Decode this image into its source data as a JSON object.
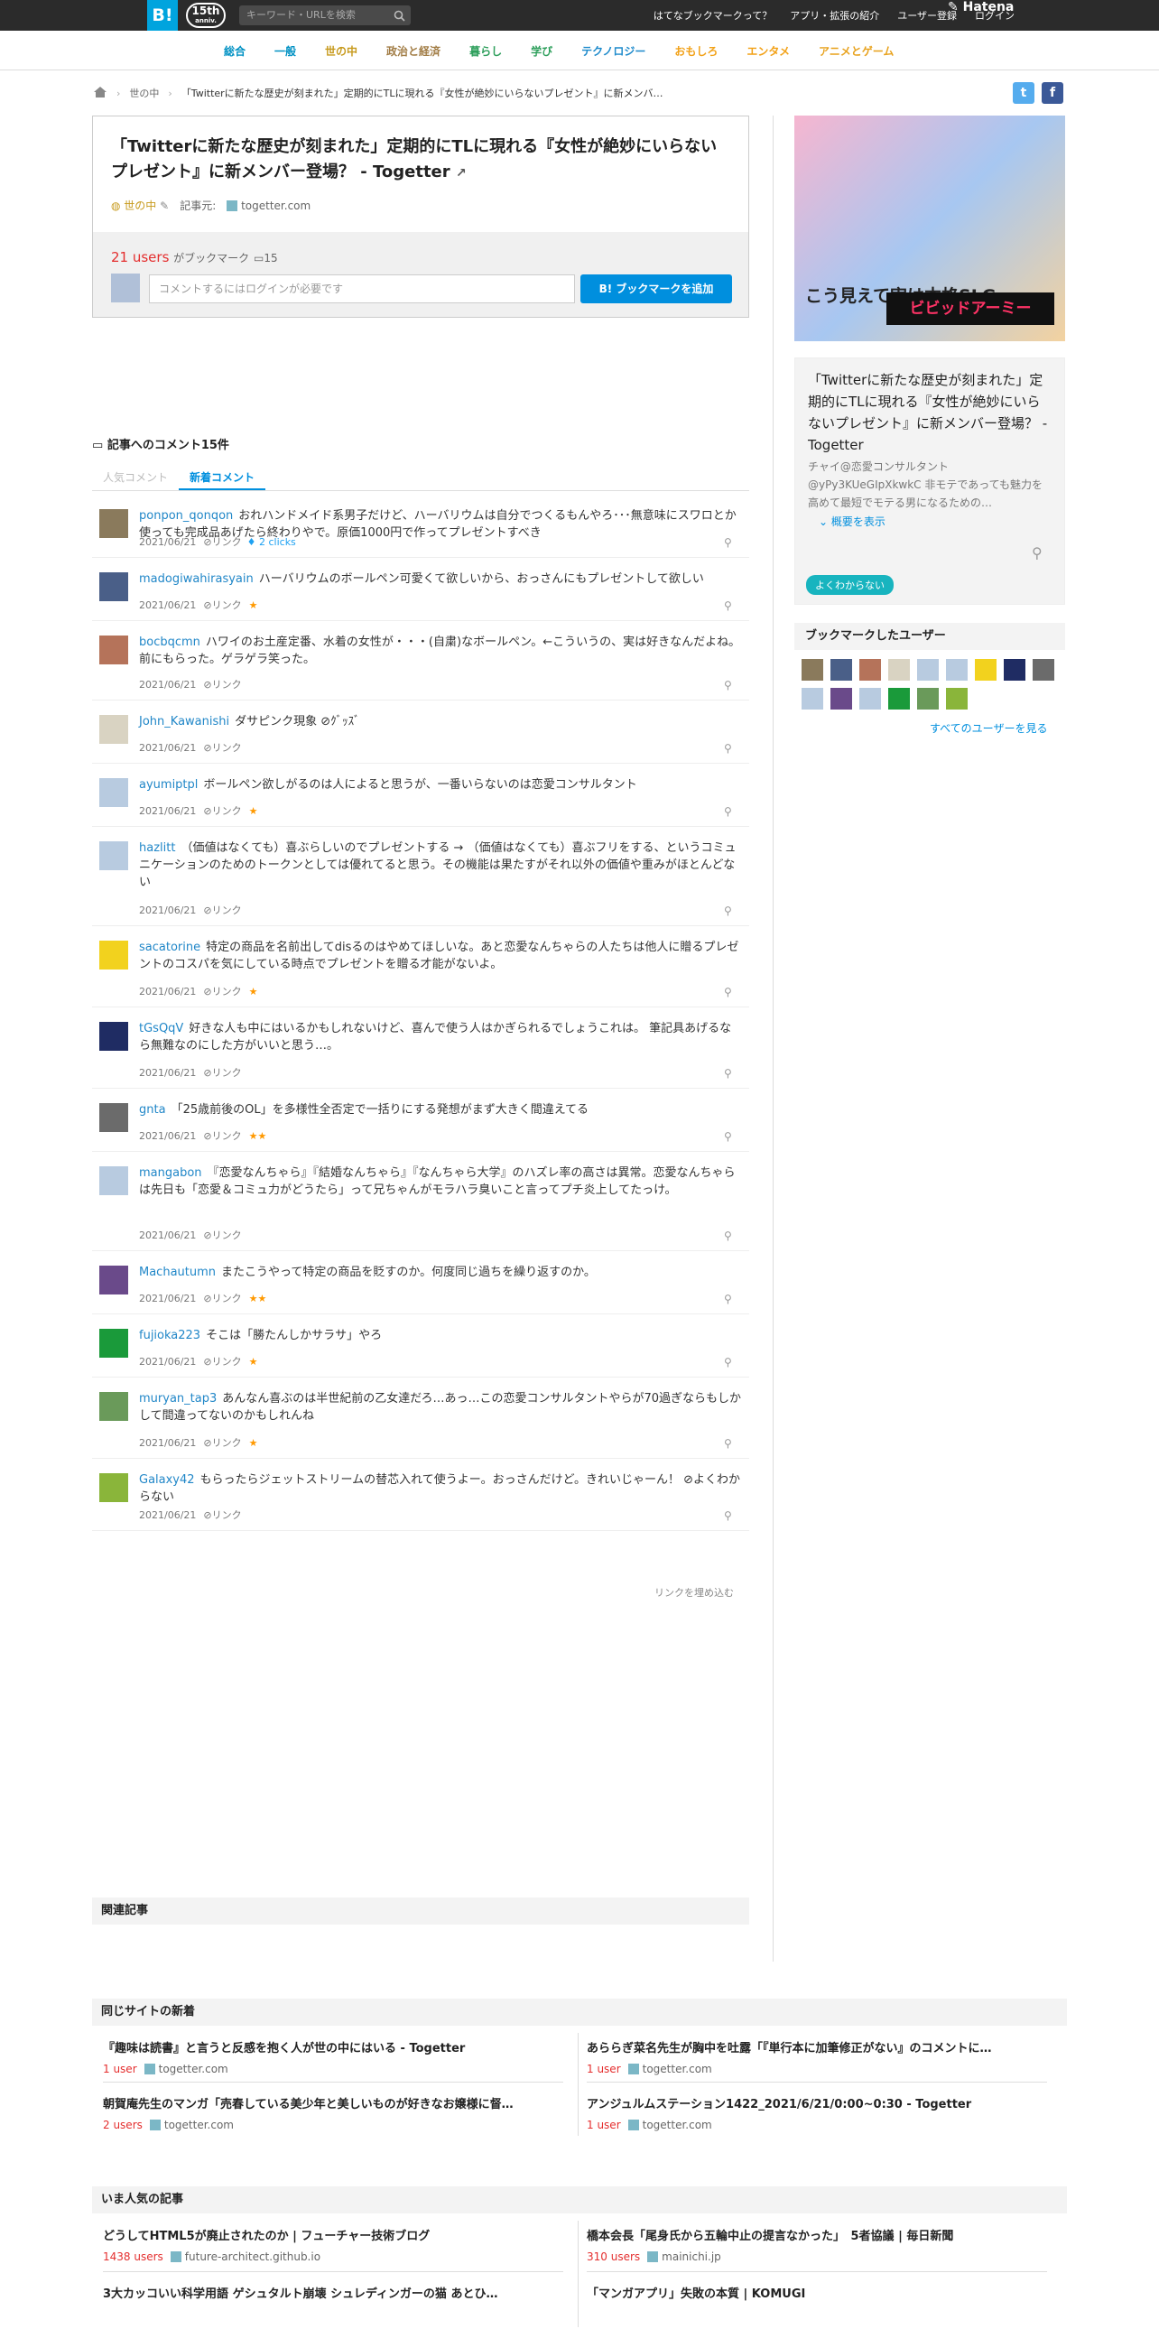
{
  "topbar": {
    "logo": "B!",
    "anniversary": "15th",
    "anniversary_sub": "anniv.",
    "search_placeholder": "キーワード・URLを検索",
    "nav": [
      "はてなブックマークって？",
      "アプリ・拡張の紹介",
      "ユーザー登録",
      "ログイン"
    ],
    "brand": "Hatena"
  },
  "categories": [
    {
      "label": "総合",
      "color": "#0091c3"
    },
    {
      "label": "一般",
      "color": "#0091c3"
    },
    {
      "label": "世の中",
      "color": "#c79a1d"
    },
    {
      "label": "政治と経済",
      "color": "#a27d46"
    },
    {
      "label": "暮らし",
      "color": "#2e9f5c"
    },
    {
      "label": "学び",
      "color": "#2e9f5c"
    },
    {
      "label": "テクノロジー",
      "color": "#1d8acb"
    },
    {
      "label": "おもしろ",
      "color": "#f2a117"
    },
    {
      "label": "エンタメ",
      "color": "#f2a117"
    },
    {
      "label": "アニメとゲーム",
      "color": "#e8a21d"
    }
  ],
  "breadcrumb": {
    "category": "世の中",
    "title": "「Twitterに新たな歴史が刻まれた」定期的にTLに現れる『女性が絶妙にいらないプレゼント』に新メンバ…"
  },
  "entry": {
    "title": "「Twitterに新たな歴史が刻まれた」定期的にTLに現れる『女性が絶妙にいらないプレゼント』に新メンバー登場？ - Togetter",
    "category": "世の中",
    "source_label": "記事元:",
    "source": "togetter.com",
    "users": "21 users",
    "users_suffix": "がブックマーク",
    "comment_count": "15",
    "comment_placeholder": "コメントするにはログインが必要です",
    "add_button": "B! ブックマークを追加"
  },
  "comments_header": "記事へのコメント15件",
  "tabs": [
    "人気コメント",
    "新着コメント"
  ],
  "comments": [
    {
      "user": "ponpon_qonqon",
      "text": "おれハンドメイド系男子だけど、ハーバリウムは自分でつくるもんやろ･･･無意味にスワロとか使っても完成品あげたら終わりやで。原価1000円で作ってプレゼントすべき",
      "date": "2021/06/21",
      "link": "リンク",
      "stars": "",
      "clicks": "2 clicks",
      "avatar": "#8a7a5c"
    },
    {
      "user": "madogiwahirasyain",
      "text": "ハーバリウムのボールペン可愛くて欲しいから、おっさんにもプレゼントして欲しい",
      "date": "2021/06/21",
      "link": "リンク",
      "stars": "★",
      "clicks": "",
      "avatar": "#4a5f88"
    },
    {
      "user": "bocbqcmn",
      "text": "ハワイのお土産定番、水着の女性が・・・(自粛)なボールペン。←こういうの、実は好きなんだよね。前にもらった。ゲラゲラ笑った。",
      "date": "2021/06/21",
      "link": "リンク",
      "stars": "",
      "clicks": "",
      "avatar": "#b5735a"
    },
    {
      "user": "John_Kawanishi",
      "text": "ダサピンク現象  ⊘ｸﾞｯｽﾞ",
      "date": "2021/06/21",
      "link": "リンク",
      "stars": "",
      "clicks": "",
      "avatar": "#d9d3c2"
    },
    {
      "user": "ayumiptpl",
      "text": "ボールペン欲しがるのは人によると思うが、一番いらないのは恋愛コンサルタント",
      "date": "2021/06/21",
      "link": "リンク",
      "stars": "★",
      "clicks": "",
      "avatar": "#b8cbe0"
    },
    {
      "user": "hazlitt",
      "text": "（価値はなくても）喜ぶらしいのでプレゼントする → （価値はなくても）喜ぶフリをする、というコミュニケーションのためのトークンとしては優れてると思う。その機能は果たすがそれ以外の価値や重みがほとんどない",
      "date": "2021/06/21",
      "link": "リンク",
      "stars": "",
      "clicks": "",
      "avatar": "#b8cbe0"
    },
    {
      "user": "sacatorine",
      "text": "特定の商品を名前出してdisるのはやめてほしいな。あと恋愛なんちゃらの人たちは他人に贈るプレゼントのコスパを気にしている時点でプレゼントを贈る才能がないよ。",
      "date": "2021/06/21",
      "link": "リンク",
      "stars": "★",
      "clicks": "",
      "avatar": "#f2d21e"
    },
    {
      "user": "tGsQqV",
      "text": "好きな人も中にはいるかもしれないけど、喜んで使う人はかぎられるでしょうこれは。 筆記具あげるなら無難なのにした方がいいと思う…。",
      "date": "2021/06/21",
      "link": "リンク",
      "stars": "",
      "clicks": "",
      "avatar": "#1f2c63"
    },
    {
      "user": "gnta",
      "text": "「25歳前後のOL」を多様性全否定で一括りにする発想がまず大きく間違えてる",
      "date": "2021/06/21",
      "link": "リンク",
      "stars": "★★",
      "clicks": "",
      "avatar": "#6b6b6b"
    },
    {
      "user": "mangabon",
      "text": "『恋愛なんちゃら』『結婚なんちゃら』『なんちゃら大学』のハズレ率の高さは異常。恋愛なんちゃらは先日も「恋愛＆コミュ力がどうたら」って兄ちゃんがモラハラ臭いこと言ってプチ炎上してたっけ。",
      "date": "2021/06/21",
      "link": "リンク",
      "stars": "",
      "clicks": "",
      "avatar": "#b8cbe0"
    },
    {
      "user": "Machautumn",
      "text": "またこうやって特定の商品を貶すのか。何度同じ過ちを繰り返すのか。",
      "date": "2021/06/21",
      "link": "リンク",
      "stars": "★★",
      "clicks": "",
      "avatar": "#6a4a8a"
    },
    {
      "user": "fujioka223",
      "text": "そこは「勝たんしかサラサ」やろ",
      "date": "2021/06/21",
      "link": "リンク",
      "stars": "★",
      "clicks": "",
      "avatar": "#1a9a3a"
    },
    {
      "user": "muryan_tap3",
      "text": "あんなん喜ぶのは半世紀前の乙女達だろ…あっ…この恋愛コンサルタントやらが70過ぎならもしかして間違ってないのかもしれんね",
      "date": "2021/06/21",
      "link": "リンク",
      "stars": "★",
      "clicks": "",
      "avatar": "#6a9a5a"
    },
    {
      "user": "Galaxy42",
      "text": "もらったらジェットストリームの替芯入れて使うよー。おっさんだけど。きれいじゃーん！  ⊘よくわからない",
      "date": "2021/06/21",
      "link": "リンク",
      "stars": "",
      "clicks": "",
      "avatar": "#8ab53a"
    }
  ],
  "embed_link": "リンクを埋め込む",
  "related_header": "関連記事",
  "sidebar": {
    "ad_text": "こう見えて実は本格SLG",
    "ad_brand": "ビビッドアーミー",
    "summary_title": "「Twitterに新たな歴史が刻まれた」定期的にTLに現れる『女性が絶妙にいらないプレゼント』に新メンバー登場？ - Togetter",
    "summary_desc": "チャイ@恋愛コンサルタント @yPy3KUeGIpXkwkC 非モテであっても魅力を高めて最短でモテる男になるための…",
    "more_label": "概要を表示",
    "tag": "よくわからない",
    "bookmark_users_header": "ブックマークしたユーザー",
    "see_all": "すべてのユーザーを見る",
    "user_avatars": [
      "#8a7a5c",
      "#4a5f88",
      "#b5735a",
      "#d9d3c2",
      "#b8cbe0",
      "#b8cbe0",
      "#f2d21e",
      "#1f2c63",
      "#6b6b6b",
      "#b8cbe0",
      "#6a4a8a",
      "#b8cbe0",
      "#1a9a3a",
      "#6a9a5a",
      "#8ab53a"
    ]
  },
  "same_site": {
    "header": "同じサイトの新着",
    "items": [
      {
        "title": "『趣味は読書』と言うと反感を抱く人が世の中にはいる - Togetter",
        "users": "1 user",
        "source": "togetter.com"
      },
      {
        "title": "あららぎ菜名先生が胸中を吐露「『単行本に加筆修正がない』のコメントに…",
        "users": "1 user",
        "source": "togetter.com"
      },
      {
        "title": "朝賀庵先生のマンガ「売春している美少年と美しいものが好きなお嬢様に督…",
        "users": "2 users",
        "source": "togetter.com"
      },
      {
        "title": "アンジュルムステーション1422_2021/6/21/0:00~0:30 - Togetter",
        "users": "1 user",
        "source": "togetter.com"
      }
    ]
  },
  "popular": {
    "header": "いま人気の記事",
    "items": [
      {
        "title": "どうしてHTML5が廃止されたのか | フューチャー技術ブログ",
        "users": "1438 users",
        "source": "future-architect.github.io"
      },
      {
        "title": "橋本会長「尾身氏から五輪中止の提言なかった」　5者協議 | 毎日新聞",
        "users": "310 users",
        "source": "mainichi.jp"
      },
      {
        "title": "3大カッコいい科学用語 ゲシュタルト崩壊 シュレディンガーの猫 あとひ…",
        "users": "",
        "source": ""
      },
      {
        "title": "「マンガアプリ」失敗の本質 | KOMUGI",
        "users": "",
        "source": ""
      }
    ]
  }
}
